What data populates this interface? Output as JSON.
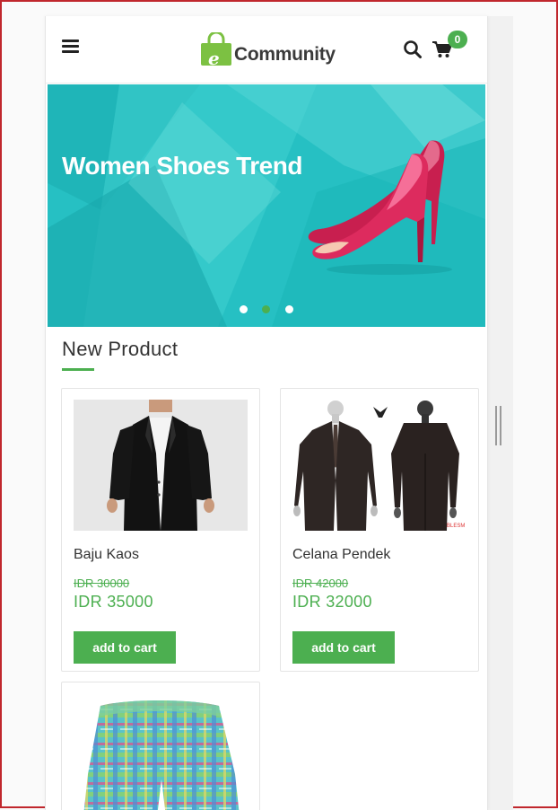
{
  "app": {
    "logo_letter": "e",
    "logo_text": "Community"
  },
  "header": {
    "cart_count": "0",
    "icons": [
      "hamburger-menu-icon",
      "search-icon",
      "cart-icon"
    ]
  },
  "banner": {
    "title": "Women Shoes Trend",
    "slides": 3,
    "active_slide": 2,
    "colors": {
      "base": "#29c3c5",
      "light": "#5fd9d9",
      "dark": "#1aa9ad",
      "shoe": "#d8265a"
    }
  },
  "section": {
    "title": "New Product"
  },
  "products": [
    {
      "name": "Baju Kaos",
      "old_price": "IDR 30000",
      "price": "IDR 35000",
      "button": "add to cart",
      "image": "black-suit"
    },
    {
      "name": "Celana Pendek",
      "old_price": "IDR 42000",
      "price": "IDR 32000",
      "button": "add to cart",
      "image": "dark-suit-front-back"
    },
    {
      "name": "",
      "old_price": "",
      "price": "",
      "button": "",
      "image": "plaid-shorts"
    }
  ],
  "colors": {
    "accent": "#4caf50",
    "text": "#333333",
    "frame": "#c0272d"
  }
}
